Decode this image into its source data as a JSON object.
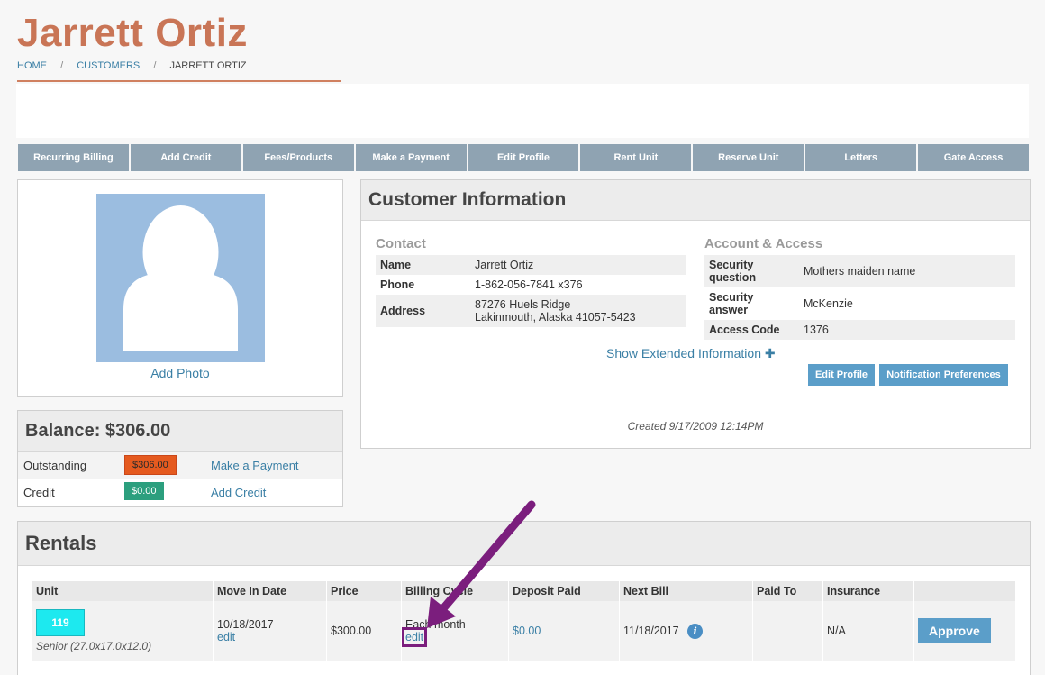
{
  "page": {
    "title": "Jarrett Ortiz",
    "breadcrumb": [
      "HOME",
      "CUSTOMERS",
      "JARRETT ORTIZ"
    ],
    "breadcrumb_sep": "/"
  },
  "nav": [
    "Recurring Billing",
    "Add Credit",
    "Fees/Products",
    "Make a Payment",
    "Edit Profile",
    "Rent Unit",
    "Reserve Unit",
    "Letters",
    "Gate Access"
  ],
  "photo": {
    "add_label": "Add Photo",
    "placeholder_color": "#9bbde0"
  },
  "balance": {
    "title": "Balance: $306.00",
    "outstanding_label": "Outstanding",
    "outstanding_value": "$306.00",
    "outstanding_link": "Make a Payment",
    "credit_label": "Credit",
    "credit_value": "$0.00",
    "credit_link": "Add Credit"
  },
  "customer_info": {
    "title": "Customer Information",
    "contact_title": "Contact",
    "contact": {
      "name_label": "Name",
      "name": "Jarrett Ortiz",
      "phone_label": "Phone",
      "phone": "1-862-056-7841 x376",
      "address_label": "Address",
      "address_line1": "87276 Huels Ridge",
      "address_line2": "Lakinmouth, Alaska 41057-5423"
    },
    "account_title": "Account & Access",
    "account": {
      "security_question_label": "Security question",
      "security_question": "Mothers maiden name",
      "security_answer_label": "Security answer",
      "security_answer": "McKenzie",
      "access_code_label": "Access Code",
      "access_code": "1376"
    },
    "show_extended": "Show Extended Information",
    "edit_profile_btn": "Edit Profile",
    "notification_btn": "Notification Preferences",
    "created": "Created 9/17/2009 12:14PM"
  },
  "rentals": {
    "title": "Rentals",
    "columns": [
      "Unit",
      "Move In Date",
      "Price",
      "Billing Cycle",
      "Deposit Paid",
      "Next Bill",
      "Paid To",
      "Insurance",
      ""
    ],
    "row": {
      "unit": "119",
      "unit_desc": "Senior (27.0x17.0x12.0)",
      "move_in": "10/18/2017",
      "move_in_edit": "edit",
      "price": "$300.00",
      "billing": "Each month",
      "billing_edit": "edit",
      "deposit": "$0.00",
      "next_bill": "11/18/2017",
      "paid_to": "",
      "insurance": "N/A",
      "action": "Approve"
    }
  },
  "colors": {
    "title": "#c97556",
    "nav": "#8fa3b2",
    "button": "#5b9ec9",
    "outstanding": "#e55a1f",
    "credit": "#2c9f7e",
    "unit_badge": "#1de9ef",
    "annotation_arrow": "#7b1e7d"
  }
}
